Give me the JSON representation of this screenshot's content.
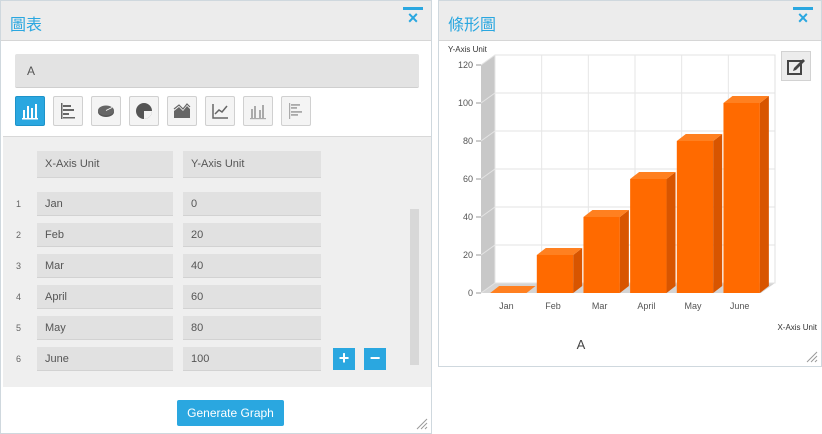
{
  "left_panel": {
    "title": "圖表",
    "close_label": "×",
    "chart_name_value": "A",
    "chart_types": [
      {
        "icon": "vertical-bar-chart-icon",
        "active": true
      },
      {
        "icon": "horizontal-bar-chart-icon",
        "active": false
      },
      {
        "icon": "pie-3d-chart-icon",
        "active": false
      },
      {
        "icon": "pie-chart-icon",
        "active": false
      },
      {
        "icon": "area-chart-icon",
        "active": false
      },
      {
        "icon": "line-chart-icon",
        "active": false
      },
      {
        "icon": "grouped-bar-chart-icon",
        "active": false
      },
      {
        "icon": "grouped-horizontal-bar-chart-icon",
        "active": false
      }
    ],
    "table": {
      "x_header": "X-Axis Unit",
      "y_header": "Y-Axis Unit",
      "rows": [
        {
          "num": "1",
          "x": "Jan",
          "y": "0"
        },
        {
          "num": "2",
          "x": "Feb",
          "y": "20"
        },
        {
          "num": "3",
          "x": "Mar",
          "y": "40"
        },
        {
          "num": "4",
          "x": "April",
          "y": "60"
        },
        {
          "num": "5",
          "x": "May",
          "y": "80"
        },
        {
          "num": "6",
          "x": "June",
          "y": "100"
        }
      ]
    },
    "add_row_label": "+",
    "remove_row_label": "−",
    "generate_label": "Generate Graph"
  },
  "right_panel": {
    "title": "條形圖",
    "close_label": "×"
  },
  "accent_color": "#2aa7e0",
  "bar_color": "#ff6a00",
  "chart_data": {
    "type": "bar",
    "style": "3d",
    "categories": [
      "Jan",
      "Feb",
      "Mar",
      "April",
      "May",
      "June"
    ],
    "values": [
      0,
      20,
      40,
      60,
      80,
      100
    ],
    "ylim": [
      0,
      120
    ],
    "yticks": [
      "0",
      "20",
      "40",
      "60",
      "80",
      "100",
      "120"
    ],
    "ylabel": "Y-Axis Unit",
    "xlabel": "X-Axis Unit",
    "series_label": "A",
    "grid": true
  }
}
